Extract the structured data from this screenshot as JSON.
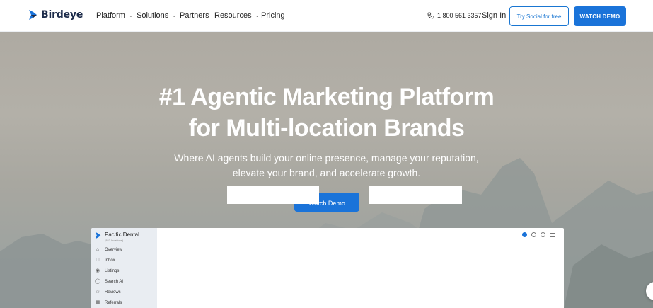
{
  "brand": {
    "name": "Birdeye",
    "color": "#1c2b4a",
    "accent": "#1a73d9"
  },
  "nav": {
    "items": [
      {
        "label": "Platform",
        "has_dropdown": true
      },
      {
        "label": "Solutions",
        "has_dropdown": true
      },
      {
        "label": "Partners",
        "has_dropdown": false
      },
      {
        "label": "Resources",
        "has_dropdown": true
      },
      {
        "label": "Pricing",
        "has_dropdown": false
      }
    ],
    "phone": "1 800 561 3357",
    "sign_in": "Sign In",
    "try_button": "Try Social for free",
    "demo_button": "WATCH DEMO"
  },
  "hero": {
    "headline_line1": "#1 Agentic Marketing Platform",
    "headline_line2": "for Multi-location Brands",
    "sub_line1": "Where AI agents build your online presence, manage your reputation,",
    "sub_line2": "elevate your brand, and accelerate growth.",
    "cta": "Watch Demo"
  },
  "app_preview": {
    "account_name": "Pacific Dental",
    "locations": "(843 locations)",
    "sidebar": [
      {
        "label": "Overview",
        "icon": "home-icon"
      },
      {
        "label": "Inbox",
        "icon": "chat-icon"
      },
      {
        "label": "Listings",
        "icon": "pin-icon"
      },
      {
        "label": "Search AI",
        "icon": "bulb-icon"
      },
      {
        "label": "Reviews",
        "icon": "star-icon"
      },
      {
        "label": "Referrals",
        "icon": "gift-icon"
      }
    ]
  }
}
